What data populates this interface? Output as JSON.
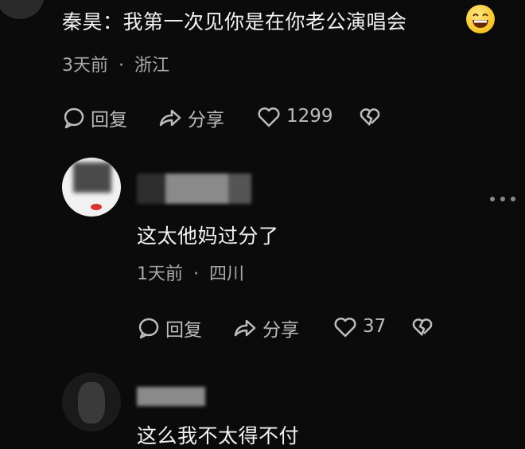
{
  "comment1": {
    "text": "秦昊：我第一次见你是在你老公演唱会",
    "emoji_icon": "grinning-face-icon",
    "time": "3天前",
    "location": "浙江",
    "reply_label": "回复",
    "share_label": "分享",
    "like_count": "1299"
  },
  "comment2": {
    "text": "这太他妈过分了",
    "time": "1天前",
    "location": "四川",
    "reply_label": "回复",
    "share_label": "分享",
    "like_count": "37"
  },
  "comment3": {
    "text_partial": "这么我不太得不付"
  },
  "icons": {
    "reply": "comment-bubble-icon",
    "share": "share-arrow-icon",
    "like": "heart-icon",
    "dislike": "broken-heart-icon",
    "more": "more-dots-icon"
  },
  "colors": {
    "background": "#0b0b0b",
    "text": "#f2f2f2",
    "meta": "#a9a9a9",
    "icon": "#bdbdbd"
  },
  "separator": "·"
}
